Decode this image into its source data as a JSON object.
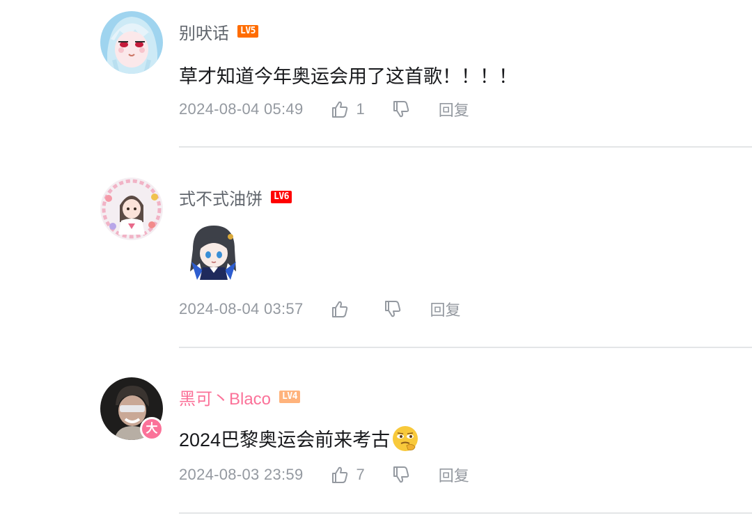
{
  "comments": [
    {
      "username": "别吠话",
      "level": "LV5",
      "level_color": "#ff6c00",
      "content": "草才知道今年奥运会用了这首歌！！！！",
      "time": "2024-08-04 05:49",
      "like_count": "1",
      "reply_label": "回复",
      "avatar_icon": "anime-girl-avatar"
    },
    {
      "username": "式不式油饼",
      "level": "LV6",
      "level_color": "#ff0000",
      "content": "",
      "sticker_icon": "anime-chibi-sticker",
      "time": "2024-08-04 03:57",
      "like_count": "",
      "reply_label": "回复",
      "avatar_icon": "anime-girl-floral-avatar"
    },
    {
      "username": "黑可丶Blaco",
      "level": "LV4",
      "level_color": "#ffb37c",
      "username_color": "#fb7299",
      "content": "2024巴黎奥运会前来考古",
      "emoji_icon": "thinking-emoji",
      "time": "2024-08-03 23:59",
      "like_count": "7",
      "reply_label": "回复",
      "avatar_icon": "person-avatar",
      "vip_badge": "大"
    }
  ],
  "colors": {
    "text_primary": "#18191c",
    "text_secondary": "#61666d",
    "text_meta": "#9499a0",
    "divider": "#e3e5e7",
    "vip_pink": "#fb7299"
  }
}
